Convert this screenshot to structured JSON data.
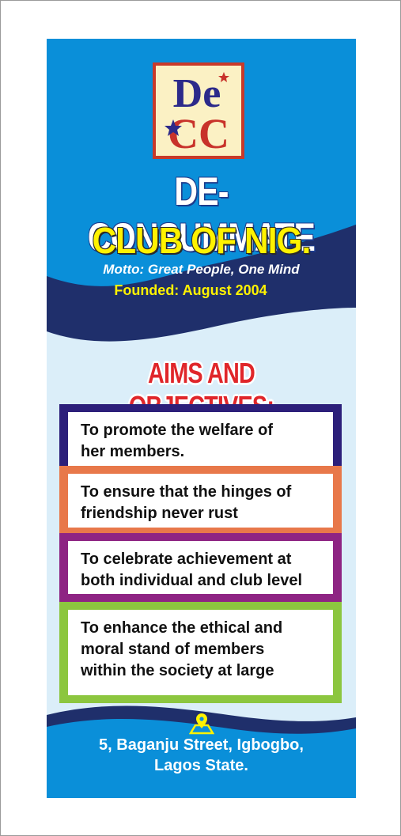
{
  "club": {
    "name_line1": "DE-CONSUMMATE",
    "name_line2": "CLUB OF NIG.",
    "motto": "Motto: Great People, One Mind",
    "founded": "Founded: August 2004"
  },
  "logo": {
    "letters_top": "De",
    "letters_bottom": "CC"
  },
  "aims": {
    "title": "AIMS AND OBJECTIVES:",
    "items": [
      {
        "text": "To promote the welfare of her members.",
        "lines": [
          "To promote the welfare of",
          "her members."
        ],
        "color": "#2c1f7a"
      },
      {
        "text": "To ensure that the hinges of friendship never rust",
        "lines": [
          "To ensure that the hinges of",
          "friendship never rust"
        ],
        "color": "#e8784a"
      },
      {
        "text": "To celebrate achievement at both individual and club level",
        "lines": [
          "To celebrate achievement at",
          "both individual and club level"
        ],
        "color": "#8e2483"
      },
      {
        "text": "To enhance the ethical and moral stand of members within the society at large",
        "lines": [
          "To enhance the ethical and",
          "moral stand of members",
          "within the society at large"
        ],
        "color": "#8cc63f"
      }
    ]
  },
  "address": {
    "line1": "5, Baganju Street, Igbogbo,",
    "line2": "Lagos State."
  },
  "colors": {
    "banner_blue": "#0a8fd9",
    "navy_wave": "#1f2f6b",
    "title_red": "#e0262a",
    "motto_yellow": "#fff200"
  },
  "icons": {
    "location": "map-pin-icon"
  }
}
